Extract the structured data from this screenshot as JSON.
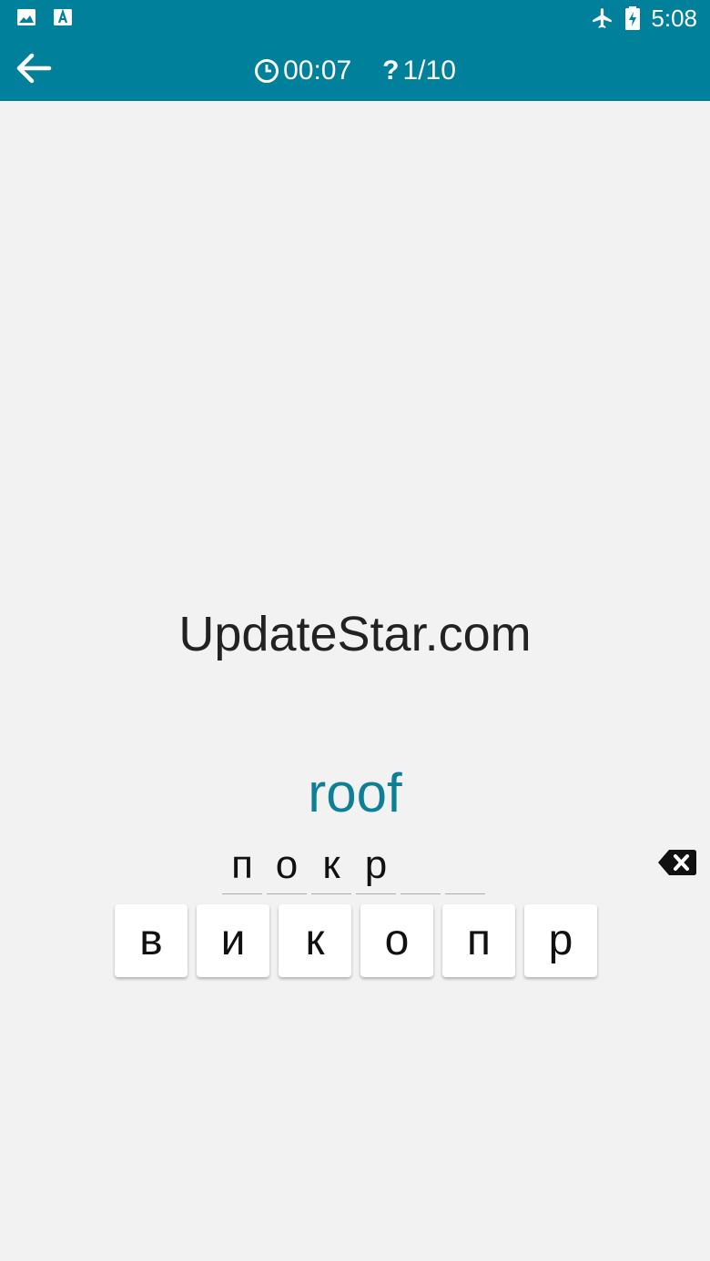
{
  "status_bar": {
    "time": "5:08",
    "left_icons": [
      "image-icon",
      "font-icon"
    ],
    "right_icons": [
      "airplane-icon",
      "battery-charging-icon"
    ]
  },
  "toolbar": {
    "back_icon": "arrow-left-icon",
    "timer": "00:07",
    "progress": "1/10",
    "progress_icon": "?"
  },
  "content": {
    "watermark": "UpdateStar.com",
    "target_word": "roof",
    "answer_slots": [
      "п",
      "о",
      "к",
      "р",
      "",
      ""
    ],
    "letter_tiles": [
      "в",
      "и",
      "к",
      "о",
      "п",
      "р"
    ],
    "backspace_icon": "backspace-icon"
  },
  "colors": {
    "appbar": "#00809a",
    "background": "#f2f2f2",
    "accent_text": "#0d7f96"
  }
}
